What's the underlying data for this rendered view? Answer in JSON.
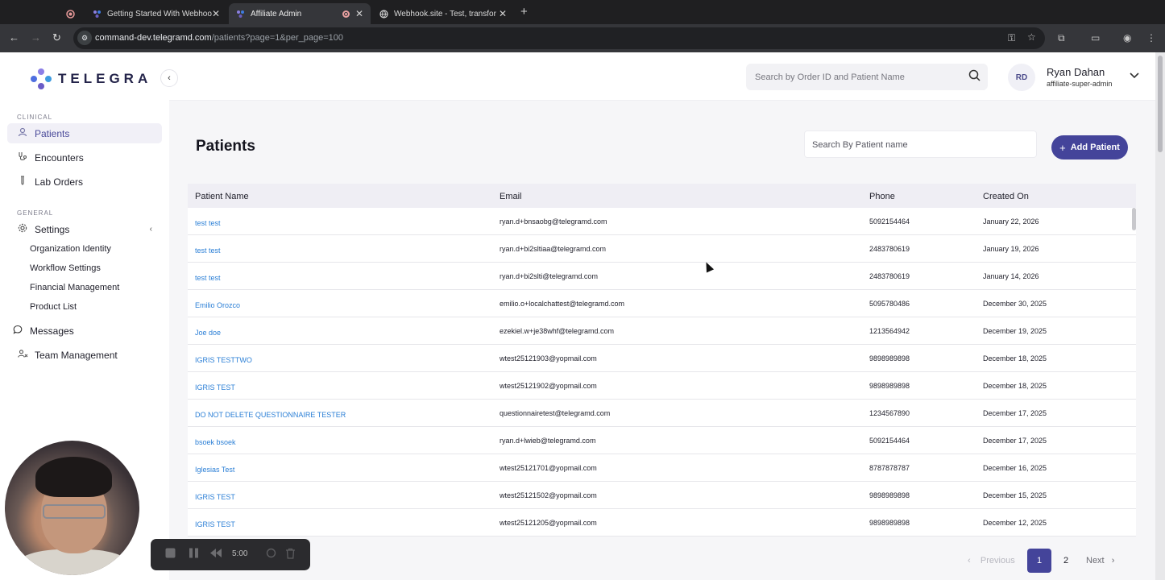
{
  "browser": {
    "tabs": [
      {
        "title": "",
        "icon": "record-icon"
      },
      {
        "title": "Getting Started With Webhoo",
        "icon": "telegra-favicon"
      },
      {
        "title": "Affiliate Admin",
        "icon": "telegra-favicon",
        "active": true
      },
      {
        "title": "Webhook.site - Test, transfor",
        "icon": "globe-icon"
      }
    ],
    "url_host": "command-dev.telegramd.com",
    "url_path": "/patients?page=1&per_page=100"
  },
  "sidebar": {
    "brand": "TELEGRA",
    "sections": [
      {
        "label": "CLINICAL"
      },
      {
        "label": "GENERAL"
      }
    ],
    "clinical_items": [
      {
        "label": "Patients",
        "icon": "person-icon",
        "active": true
      },
      {
        "label": "Encounters",
        "icon": "stethoscope-icon"
      },
      {
        "label": "Lab Orders",
        "icon": "test-tube-icon"
      }
    ],
    "settings": {
      "label": "Settings",
      "icon": "gear-icon"
    },
    "settings_sub": [
      {
        "label": "Organization Identity"
      },
      {
        "label": "Workflow Settings"
      },
      {
        "label": "Financial Management"
      },
      {
        "label": "Product List"
      }
    ],
    "messages": {
      "label": "Messages",
      "icon": "chat-icon"
    },
    "team": {
      "label": "Team Management",
      "icon": "team-icon"
    }
  },
  "header": {
    "search_placeholder": "Search by Order ID and Patient Name",
    "user_initials": "RD",
    "user_name": "Ryan Dahan",
    "user_role": "affiliate-super-admin"
  },
  "page": {
    "title": "Patients",
    "search_placeholder": "Search By Patient name",
    "add_button": "Add Patient"
  },
  "table": {
    "columns": [
      "Patient Name",
      "Email",
      "Phone",
      "Created On"
    ],
    "rows": [
      {
        "name": "test test",
        "email": "ryan.d+bnsaobg@telegramd.com",
        "phone": "5092154464",
        "created": "January 22, 2026"
      },
      {
        "name": "test test",
        "email": "ryan.d+bi2sltiaa@telegramd.com",
        "phone": "2483780619",
        "created": "January 19, 2026"
      },
      {
        "name": "test test",
        "email": "ryan.d+bi2slti@telegramd.com",
        "phone": "2483780619",
        "created": "January 14, 2026"
      },
      {
        "name": "Emilio Orozco",
        "email": "emilio.o+localchattest@telegramd.com",
        "phone": "5095780486",
        "created": "December 30, 2025"
      },
      {
        "name": "Joe doe",
        "email": "ezekiel.w+je38whf@telegramd.com",
        "phone": "1213564942",
        "created": "December 19, 2025"
      },
      {
        "name": "IGRIS TESTTWO",
        "email": "wtest25121903@yopmail.com",
        "phone": "9898989898",
        "created": "December 18, 2025"
      },
      {
        "name": "IGRIS TEST",
        "email": "wtest25121902@yopmail.com",
        "phone": "9898989898",
        "created": "December 18, 2025"
      },
      {
        "name": "DO NOT DELETE QUESTIONNAIRE TESTER",
        "email": "questionnairetest@telegramd.com",
        "phone": "1234567890",
        "created": "December 17, 2025"
      },
      {
        "name": "bsoek bsoek",
        "email": "ryan.d+lwieb@telegramd.com",
        "phone": "5092154464",
        "created": "December 17, 2025"
      },
      {
        "name": "Iglesias Test",
        "email": "wtest25121701@yopmail.com",
        "phone": "8787878787",
        "created": "December 16, 2025"
      },
      {
        "name": "IGRIS TEST",
        "email": "wtest25121502@yopmail.com",
        "phone": "9898989898",
        "created": "December 15, 2025"
      },
      {
        "name": "IGRIS TEST",
        "email": "wtest25121205@yopmail.com",
        "phone": "9898989898",
        "created": "December 12, 2025"
      }
    ]
  },
  "pagination": {
    "previous": "Previous",
    "pages": [
      "1",
      "2"
    ],
    "current": "1",
    "next": "Next"
  },
  "recorder": {
    "time": "5:00"
  },
  "colors": {
    "accent": "#44449a",
    "link": "#2b7fd6"
  }
}
